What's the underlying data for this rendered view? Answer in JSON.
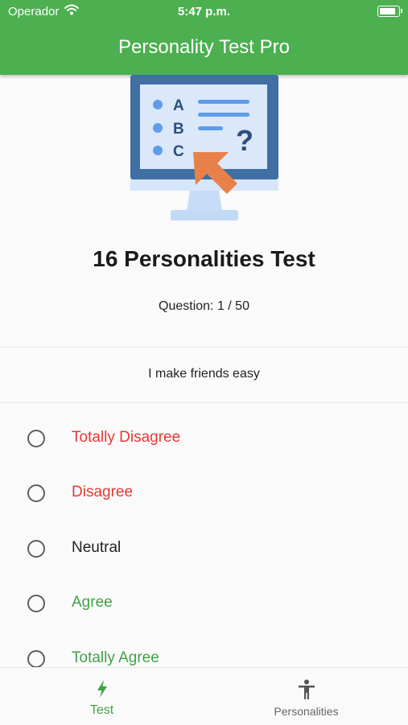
{
  "status_bar": {
    "carrier": "Operador",
    "time": "5:47 p.m.",
    "battery_level": 1.0
  },
  "app_bar": {
    "title": "Personality Test Pro"
  },
  "illustration": {
    "icon": "computer-quiz-illustration",
    "letters": [
      "A",
      "B",
      "C"
    ],
    "symbol": "?"
  },
  "header": {
    "title": "16 Personalities Test",
    "progress": "Question: 1 / 50"
  },
  "question": {
    "text": "I make friends easy"
  },
  "options": [
    {
      "label": "Totally Disagree",
      "color": "#e53935",
      "selected": false
    },
    {
      "label": "Disagree",
      "color": "#e53935",
      "selected": false
    },
    {
      "label": "Neutral",
      "color": "#222222",
      "selected": false
    },
    {
      "label": "Agree",
      "color": "#43a047",
      "selected": false
    },
    {
      "label": "Totally Agree",
      "color": "#43a047",
      "selected": false
    }
  ],
  "bottom_nav": {
    "items": [
      {
        "label": "Test",
        "icon": "bolt-icon",
        "active": true
      },
      {
        "label": "Personalities",
        "icon": "person-standing-icon",
        "active": false
      }
    ]
  },
  "colors": {
    "primary": "#4caf50",
    "active_nav": "#43a047",
    "inactive_nav": "#666666"
  }
}
